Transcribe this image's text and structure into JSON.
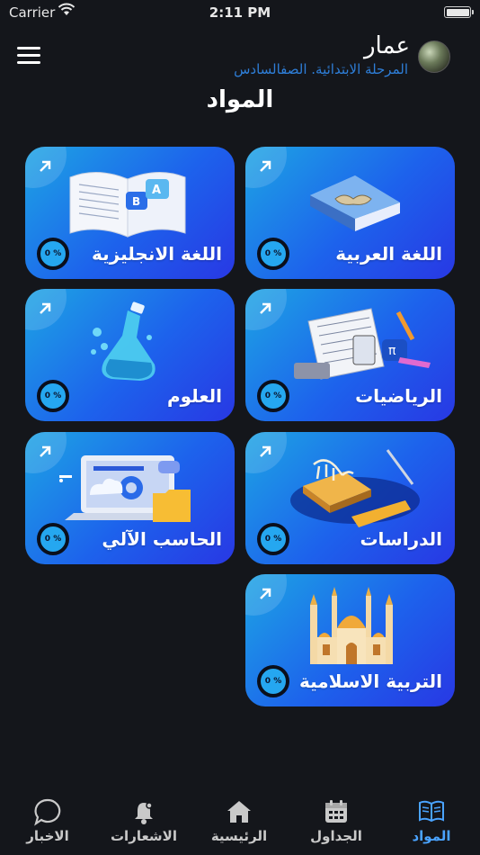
{
  "status_bar": {
    "carrier": "Carrier",
    "time": "2:11 PM"
  },
  "header": {
    "user_name": "عمار",
    "user_grade": "المرحلة الابتدائية. الصفالسادس",
    "title": "المواد"
  },
  "subjects": [
    {
      "label": "اللغة العربية",
      "progress": "% 0",
      "icon": "arabic-book-icon"
    },
    {
      "label": "اللغة الانجليزية",
      "progress": "% 0",
      "icon": "english-book-icon"
    },
    {
      "label": "الرياضيات",
      "progress": "% 0",
      "icon": "math-tools-icon"
    },
    {
      "label": "العلوم",
      "progress": "% 0",
      "icon": "flask-icon"
    },
    {
      "label": "الدراسات",
      "progress": "% 0",
      "icon": "dinosaur-fossil-icon"
    },
    {
      "label": "الحاسب الآلي",
      "progress": "% 0",
      "icon": "computer-icon"
    },
    {
      "label": "التربية الاسلامية",
      "progress": "% 0",
      "icon": "mosque-icon"
    }
  ],
  "bottom_nav": [
    {
      "label": "المواد",
      "icon": "book-icon",
      "active": true
    },
    {
      "label": "الجداول",
      "icon": "calendar-icon",
      "active": false
    },
    {
      "label": "الرئيسية",
      "icon": "home-icon",
      "active": false
    },
    {
      "label": "الاشعارات",
      "icon": "bell-icon",
      "active": false
    },
    {
      "label": "الاخبار",
      "icon": "chat-bubble-icon",
      "active": false
    }
  ],
  "colors": {
    "background": "#14161b",
    "card_gradient_start": "#1da4e4",
    "card_gradient_end": "#2838e4",
    "accent": "#2e7ed8",
    "active_nav": "#4aa3ff"
  }
}
